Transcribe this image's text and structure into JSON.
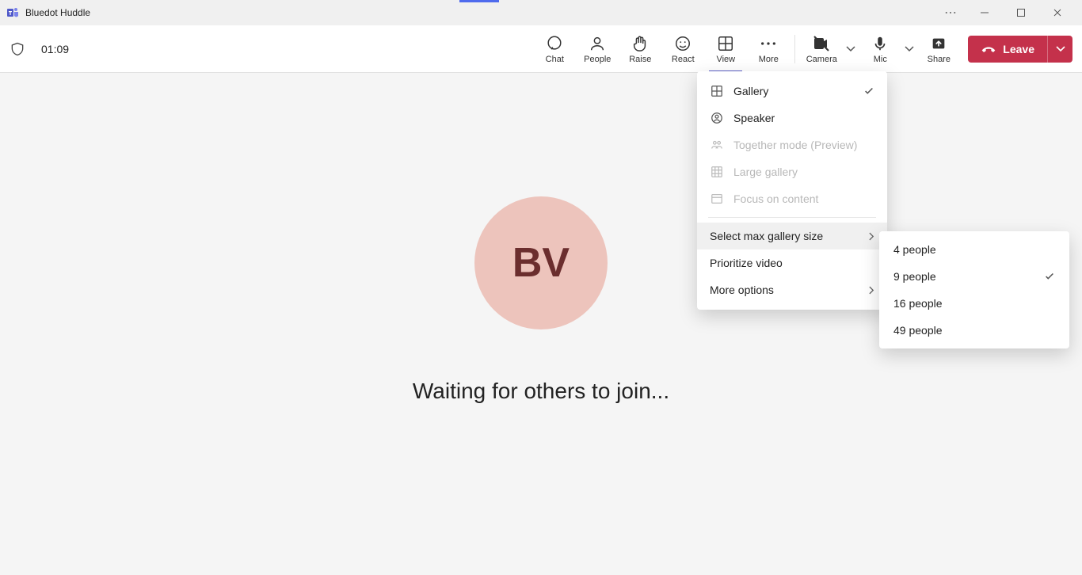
{
  "titlebar": {
    "title": "Bluedot Huddle"
  },
  "toolbar": {
    "timer": "01:09",
    "chat": "Chat",
    "people": "People",
    "raise": "Raise",
    "react": "React",
    "view": "View",
    "more": "More",
    "camera": "Camera",
    "mic": "Mic",
    "share": "Share",
    "leave": "Leave"
  },
  "view_menu": {
    "gallery": "Gallery",
    "speaker": "Speaker",
    "together": "Together mode (Preview)",
    "large_gallery": "Large gallery",
    "focus": "Focus on content",
    "select_size": "Select max gallery size",
    "prioritize": "Prioritize video",
    "more_options": "More options"
  },
  "gallery_size": {
    "opt4": "4 people",
    "opt9": "9 people",
    "opt16": "16 people",
    "opt49": "49 people",
    "selected": "9 people"
  },
  "main": {
    "avatar_initials": "BV",
    "waiting_text": "Waiting for others to join..."
  }
}
